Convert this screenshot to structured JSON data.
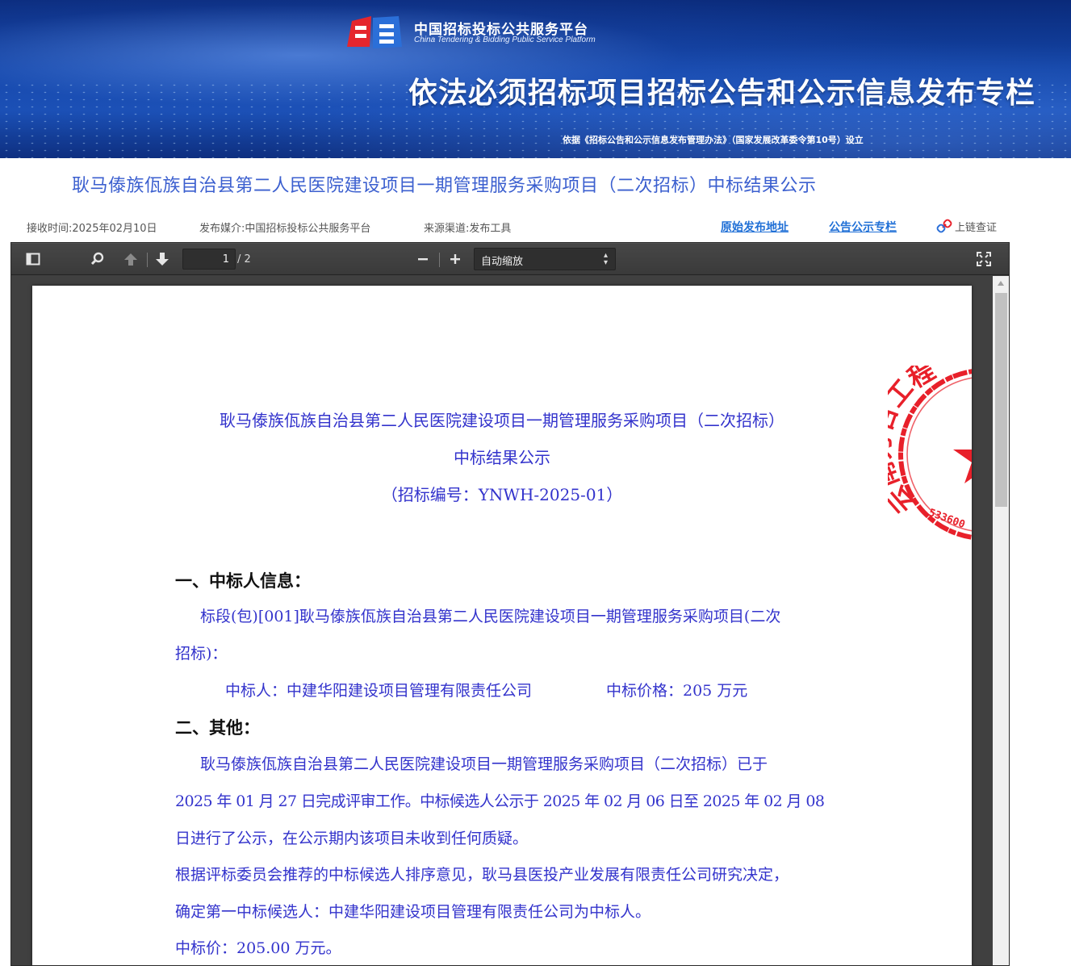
{
  "banner": {
    "logo_cn": "中国招标投标公共服务平台",
    "logo_en": "China Tendering & Bidding Public Service Platform",
    "slogan": "依法必须招标项目招标公告和公示信息发布专栏",
    "basis": "依据《招标公告和公示信息发布管理办法》（国家发展改革委令第10号）设立"
  },
  "page_title": "耿马傣族佤族自治县第二人民医院建设项目一期管理服务采购项目（二次招标）中标结果公示",
  "meta": {
    "received": "接收时间:2025年02月10日",
    "media": "发布媒介:中国招标投标公共服务平台",
    "channel": "来源渠道:发布工具",
    "original_link": "原始发布地址",
    "column_link": "公告公示专栏",
    "chain_label": "上链查证"
  },
  "viewer": {
    "current_page": "1",
    "total_pages": "/ 2",
    "zoom_label": "自动缩放",
    "zoom_minus": "−",
    "zoom_plus": "+"
  },
  "document": {
    "title_line1": "耿马傣族佤族自治县第二人民医院建设项目一期管理服务采购项目（二次招标）",
    "title_line2": "中标结果公示",
    "code_line": "（招标编号：YNWH-2025-01）",
    "section1_heading": "一、中标人信息：",
    "lot_line1": "标段(包)[001]耿马傣族佤族自治县第二人民医院建设项目一期管理服务采购项目(二次",
    "lot_line2": "招标)：",
    "winner": "中标人：中建华阳建设项目管理有限责任公司",
    "price": "中标价格：205 万元",
    "section2_heading": "二、其他：",
    "para1_line1": "耿马傣族佤族自治县第二人民医院建设项目一期管理服务采购项目（二次招标）已于",
    "para1_line2": "2025 年 01 月 27 日完成评审工作。中标候选人公示于 2025 年 02 月 06 日至 2025 年 02 月 08",
    "para1_line3": "日进行了公示，在公示期内该项目未收到任何质疑。",
    "para2_line1": "根据评标委员会推荐的中标候选人排序意见，耿马县医投产业发展有限责任公司研究决定，",
    "para2_line2": "确定第一中标候选人：中建华阳建设项目管理有限责任公司为中标人。",
    "para3": "中标价：205.00 万元。"
  },
  "seal": {
    "text_arc": "云南万合工程",
    "number": "533600"
  },
  "colors": {
    "title_blue": "#3b5fcf",
    "link_blue": "#1f6fd6",
    "doc_blue": "#3333cc",
    "seal_red": "#e8202a"
  }
}
